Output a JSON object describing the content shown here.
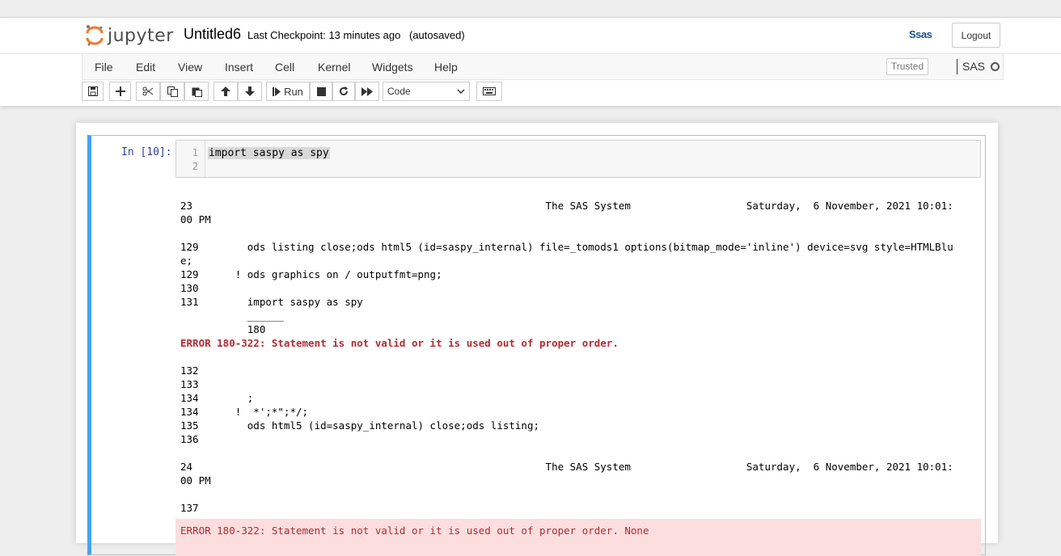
{
  "header": {
    "logo_text": "jupyter",
    "notebook_name": "Untitled6",
    "checkpoint": "Last Checkpoint: 13 minutes ago",
    "autosave": "(autosaved)",
    "kernel_logo": "Ssas",
    "logout_label": "Logout"
  },
  "menubar": {
    "items": [
      "File",
      "Edit",
      "View",
      "Insert",
      "Cell",
      "Kernel",
      "Widgets",
      "Help"
    ],
    "trusted_label": "Trusted",
    "kernel_name": "SAS"
  },
  "toolbar": {
    "buttons": [
      "save-icon",
      "plus-icon",
      "cut-icon",
      "copy-icon",
      "paste-icon",
      "arrow-up-icon",
      "arrow-down-icon",
      "run-icon",
      "stop-icon",
      "restart-icon",
      "fast-forward-icon",
      "keyboard-icon"
    ],
    "run_label": "Run",
    "cell_type": "Code",
    "cell_type_options": [
      "Code"
    ]
  },
  "cell": {
    "prompt": "In [10]:",
    "line_numbers": [
      "1",
      "2"
    ],
    "code": "import saspy as spy",
    "output_lines": [
      {
        "text": "23                                                          The SAS System                   Saturday,  6 November, 2021 10:01:",
        "type": "normal"
      },
      {
        "text": "00 PM",
        "type": "normal"
      },
      {
        "text": "",
        "type": "normal"
      },
      {
        "text": "129        ods listing close;ods html5 (id=saspy_internal) file=_tomods1 options(bitmap_mode='inline') device=svg style=HTMLBlu",
        "type": "normal"
      },
      {
        "text": "e;",
        "type": "normal"
      },
      {
        "text": "129      ! ods graphics on / outputfmt=png;",
        "type": "normal"
      },
      {
        "text": "130",
        "type": "normal"
      },
      {
        "text": "131        import saspy as spy",
        "type": "normal"
      },
      {
        "text": "           ______",
        "type": "normal"
      },
      {
        "text": "           180",
        "type": "normal"
      },
      {
        "text": "ERROR 180-322: Statement is not valid or it is used out of proper order.",
        "type": "error"
      },
      {
        "text": "",
        "type": "normal"
      },
      {
        "text": "132",
        "type": "normal"
      },
      {
        "text": "133",
        "type": "normal"
      },
      {
        "text": "134        ;",
        "type": "normal"
      },
      {
        "text": "134      !  *';*\";*/;",
        "type": "normal"
      },
      {
        "text": "135        ods html5 (id=saspy_internal) close;ods listing;",
        "type": "normal"
      },
      {
        "text": "136",
        "type": "normal"
      },
      {
        "text": "",
        "type": "normal"
      },
      {
        "text": "24                                                          The SAS System                   Saturday,  6 November, 2021 10:01:",
        "type": "normal"
      },
      {
        "text": "00 PM",
        "type": "normal"
      },
      {
        "text": "",
        "type": "normal"
      },
      {
        "text": "137",
        "type": "normal"
      }
    ],
    "stderr_text": "ERROR 180-322: Statement is not valid or it is used out of proper order. None"
  },
  "colors": {
    "cell_selected_border": "#42a5f5",
    "prompt": "#303f9f",
    "error_text": "#b22b31",
    "stderr_bg": "#fddede",
    "logo_orange": "#f37726"
  }
}
